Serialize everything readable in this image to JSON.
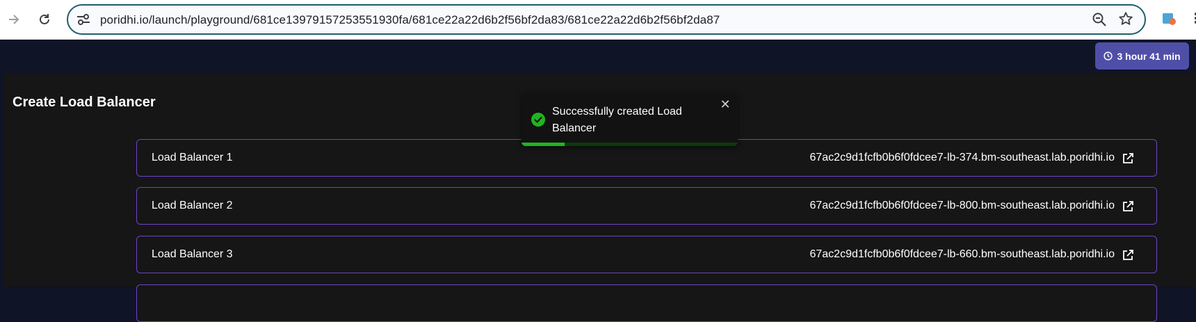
{
  "browser": {
    "url": "poridhi.io/launch/playground/681ce13979157253551930fa/681ce22a22d6b2f56bf2da83/681ce22a22d6b2f56bf2da87",
    "forward_icon": "arrow-right-icon",
    "reload_icon": "reload-icon",
    "site_settings_icon": "tune-icon",
    "zoom_icon": "zoom-out-icon",
    "bookmark_icon": "star-icon"
  },
  "timer": {
    "label": "3 hour 41 min",
    "icon": "clock-icon"
  },
  "page": {
    "title": "Create Load Balancer"
  },
  "load_balancers": [
    {
      "name": "Load Balancer 1",
      "host": "67ac2c9d1fcfb0b6f0fdcee7-lb-374.bm-southeast.lab.poridhi.io"
    },
    {
      "name": "Load Balancer 2",
      "host": "67ac2c9d1fcfb0b6f0fdcee7-lb-800.bm-southeast.lab.poridhi.io"
    },
    {
      "name": "Load Balancer 3",
      "host": "67ac2c9d1fcfb0b6f0fdcee7-lb-660.bm-southeast.lab.poridhi.io"
    }
  ],
  "toast": {
    "message": "Successfully created Load Balancer",
    "icon": "check-circle-icon",
    "close_icon": "close-icon",
    "progress": 0.2
  },
  "colors": {
    "accent_border": "#6d43c9",
    "timer_bg": "#4f4fa8",
    "success": "#1fb51f"
  }
}
